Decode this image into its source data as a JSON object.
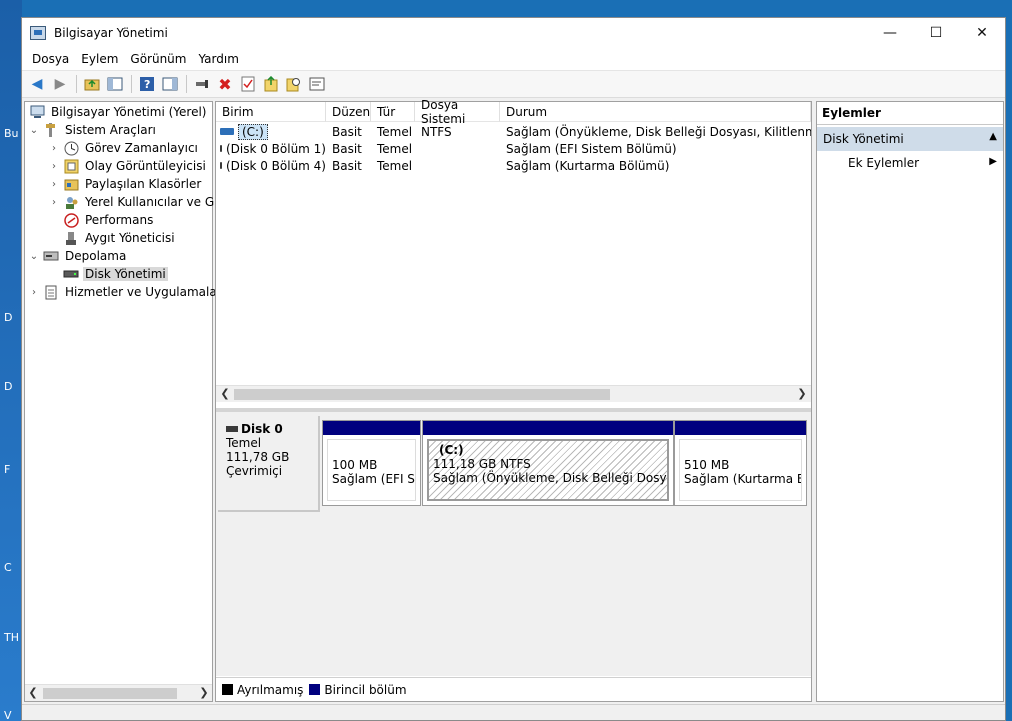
{
  "desktop": {
    "icon_labels": [
      "Bu",
      "D",
      "D",
      "F",
      "C",
      "TH",
      "V"
    ]
  },
  "window": {
    "title": "Bilgisayar Yönetimi",
    "controls": {
      "minimize": "—",
      "maximize": "☐",
      "close": "✕"
    }
  },
  "menu": [
    "Dosya",
    "Eylem",
    "Görünüm",
    "Yardım"
  ],
  "tree": {
    "root": "Bilgisayar Yönetimi (Yerel)",
    "system_tools": "Sistem Araçları",
    "task_scheduler": "Görev Zamanlayıcı",
    "event_viewer": "Olay Görüntüleyicisi",
    "shared_folders": "Paylaşılan Klasörler",
    "local_users": "Yerel Kullanıcılar ve Gru",
    "performance": "Performans",
    "device_manager": "Aygıt Yöneticisi",
    "storage": "Depolama",
    "disk_management": "Disk Yönetimi",
    "services": "Hizmetler ve Uygulamalar"
  },
  "volumes": {
    "columns": [
      "Birim",
      "Düzen",
      "Tür",
      "Dosya Sistemi",
      "Durum"
    ],
    "rows": [
      [
        "(C:)",
        "Basit",
        "Temel",
        "NTFS",
        "Sağlam (Önyükleme, Disk Belleği Dosyası, Kilitlenme Bilgisi"
      ],
      [
        "(Disk 0 Bölüm 1)",
        "Basit",
        "Temel",
        "",
        "Sağlam (EFI Sistem Bölümü)"
      ],
      [
        "(Disk 0 Bölüm 4)",
        "Basit",
        "Temel",
        "",
        "Sağlam (Kurtarma Bölümü)"
      ]
    ]
  },
  "disk": {
    "name": "Disk 0",
    "type": "Temel",
    "size": "111,78 GB",
    "status": "Çevrimiçi",
    "partitions": [
      {
        "title": "",
        "size": "100 MB",
        "status": "Sağlam (EFI Sistem Bölümü)"
      },
      {
        "title": "(C:)",
        "size": "111,18 GB NTFS",
        "status": "Sağlam (Önyükleme, Disk Belleği Dosyası, Kilitlenme Bilgisi"
      },
      {
        "title": "",
        "size": "510 MB",
        "status": "Sağlam (Kurtarma Bölümü)"
      }
    ]
  },
  "legend": {
    "unallocated": "Ayrılmamış",
    "primary": "Birincil bölüm"
  },
  "actions": {
    "header": "Eylemler",
    "section": "Disk Yönetimi",
    "more": "Ek Eylemler"
  },
  "colors": {
    "primary_partition": "#00007f",
    "unallocated": "#000000",
    "selection": "#cfdce9"
  }
}
